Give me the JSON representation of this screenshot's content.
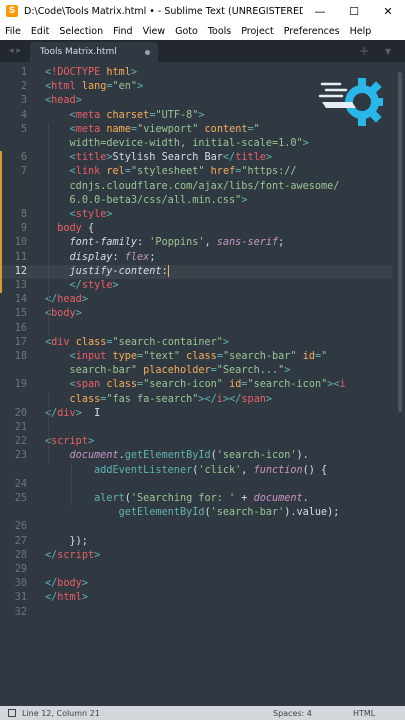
{
  "window": {
    "title": "D:\\Code\\Tools Matrix.html • - Sublime Text (UNREGISTERED)",
    "minimize_glyph": "—",
    "maximize_glyph": "☐",
    "close_glyph": "✕"
  },
  "menu": [
    "File",
    "Edit",
    "Selection",
    "Find",
    "View",
    "Goto",
    "Tools",
    "Project",
    "Preferences",
    "Help"
  ],
  "tab": {
    "label": "Tools Matrix.html",
    "nav_left": "◂ ▸",
    "right_controls": "+ ▾"
  },
  "editor": {
    "current_line": 12,
    "lines": [
      {
        "n": "1",
        "t": [
          [
            "p",
            "<"
          ],
          [
            "tag",
            "!DOCTYPE"
          ],
          [
            "txt",
            " "
          ],
          [
            "attr",
            "html"
          ],
          [
            "p",
            ">"
          ]
        ]
      },
      {
        "n": "2",
        "t": [
          [
            "p",
            "<"
          ],
          [
            "tag",
            "html"
          ],
          [
            "txt",
            " "
          ],
          [
            "attr",
            "lang"
          ],
          [
            "p",
            "="
          ],
          [
            "str",
            "\"en\""
          ],
          [
            "p",
            ">"
          ]
        ]
      },
      {
        "n": "3",
        "t": [
          [
            "p",
            "<"
          ],
          [
            "tag",
            "head"
          ],
          [
            "p",
            ">"
          ]
        ]
      },
      {
        "n": "4",
        "t": [
          [
            "txt",
            "    "
          ],
          [
            "p",
            "<"
          ],
          [
            "tag",
            "meta"
          ],
          [
            "txt",
            " "
          ],
          [
            "attr",
            "charset"
          ],
          [
            "p",
            "="
          ],
          [
            "str",
            "\"UTF-8\""
          ],
          [
            "p",
            ">"
          ]
        ]
      },
      {
        "n": "5",
        "t": [
          [
            "txt",
            "    "
          ],
          [
            "p",
            "<"
          ],
          [
            "tag",
            "meta"
          ],
          [
            "txt",
            " "
          ],
          [
            "attr",
            "name"
          ],
          [
            "p",
            "="
          ],
          [
            "str",
            "\"viewport\""
          ],
          [
            "txt",
            " "
          ],
          [
            "attr",
            "content"
          ],
          [
            "p",
            "="
          ],
          [
            "str",
            "\""
          ]
        ]
      },
      {
        "n": "",
        "t": [
          [
            "txt",
            "    "
          ],
          [
            "str",
            "width=device-width, initial-scale=1.0\""
          ],
          [
            "p",
            ">"
          ]
        ]
      },
      {
        "n": "6",
        "t": [
          [
            "txt",
            "    "
          ],
          [
            "p",
            "<"
          ],
          [
            "tag",
            "title"
          ],
          [
            "p",
            ">"
          ],
          [
            "txt",
            "Stylish Search Bar"
          ],
          [
            "p",
            "</"
          ],
          [
            "tag",
            "title"
          ],
          [
            "p",
            ">"
          ]
        ]
      },
      {
        "n": "7",
        "t": [
          [
            "txt",
            "    "
          ],
          [
            "p",
            "<"
          ],
          [
            "tag",
            "link"
          ],
          [
            "txt",
            " "
          ],
          [
            "attr",
            "rel"
          ],
          [
            "p",
            "="
          ],
          [
            "str",
            "\"stylesheet\""
          ],
          [
            "txt",
            " "
          ],
          [
            "attr",
            "href"
          ],
          [
            "p",
            "="
          ],
          [
            "str",
            "\"https://"
          ]
        ]
      },
      {
        "n": "",
        "t": [
          [
            "txt",
            "    "
          ],
          [
            "str",
            "cdnjs.cloudflare.com/ajax/libs/font-awesome/"
          ]
        ]
      },
      {
        "n": "",
        "t": [
          [
            "txt",
            "    "
          ],
          [
            "str",
            "6.0.0-beta3/css/all.min.css\""
          ],
          [
            "p",
            ">"
          ]
        ]
      },
      {
        "n": "8",
        "t": [
          [
            "txt",
            "    "
          ],
          [
            "p",
            "<"
          ],
          [
            "tag",
            "style"
          ],
          [
            "p",
            ">"
          ]
        ]
      },
      {
        "n": "9",
        "t": [
          [
            "txt",
            "  "
          ],
          [
            "tag",
            "body"
          ],
          [
            "txt",
            " {"
          ]
        ]
      },
      {
        "n": "10",
        "t": [
          [
            "txt",
            "    "
          ],
          [
            "prop",
            "font-family"
          ],
          [
            "txt",
            ": "
          ],
          [
            "str",
            "'Poppins'"
          ],
          [
            "txt",
            ", "
          ],
          [
            "dt",
            "sans-serif"
          ],
          [
            "txt",
            ";"
          ]
        ]
      },
      {
        "n": "11",
        "t": [
          [
            "txt",
            "    "
          ],
          [
            "prop",
            "display"
          ],
          [
            "txt",
            ": "
          ],
          [
            "dt",
            "flex"
          ],
          [
            "txt",
            ";"
          ]
        ]
      },
      {
        "n": "12",
        "t": [
          [
            "txt",
            "    "
          ],
          [
            "prop",
            "justify-content"
          ],
          [
            "txt",
            ":"
          ]
        ],
        "caret": true
      },
      {
        "n": "13",
        "t": [
          [
            "txt",
            "    "
          ],
          [
            "p",
            "</"
          ],
          [
            "tag",
            "style"
          ],
          [
            "p",
            ">"
          ]
        ]
      },
      {
        "n": "14",
        "t": [
          [
            "p",
            "</"
          ],
          [
            "tag",
            "head"
          ],
          [
            "p",
            ">"
          ]
        ]
      },
      {
        "n": "15",
        "t": [
          [
            "p",
            "<"
          ],
          [
            "tag",
            "body"
          ],
          [
            "p",
            ">"
          ]
        ]
      },
      {
        "n": "16",
        "t": []
      },
      {
        "n": "17",
        "t": [
          [
            "p",
            "<"
          ],
          [
            "tag",
            "div"
          ],
          [
            "txt",
            " "
          ],
          [
            "attr",
            "class"
          ],
          [
            "p",
            "="
          ],
          [
            "str",
            "\"search-container\""
          ],
          [
            "p",
            ">"
          ]
        ]
      },
      {
        "n": "18",
        "t": [
          [
            "txt",
            "    "
          ],
          [
            "p",
            "<"
          ],
          [
            "tag",
            "input"
          ],
          [
            "txt",
            " "
          ],
          [
            "attr",
            "type"
          ],
          [
            "p",
            "="
          ],
          [
            "str",
            "\"text\""
          ],
          [
            "txt",
            " "
          ],
          [
            "attr",
            "class"
          ],
          [
            "p",
            "="
          ],
          [
            "str",
            "\"search-bar\""
          ],
          [
            "txt",
            " "
          ],
          [
            "attr",
            "id"
          ],
          [
            "p",
            "="
          ],
          [
            "str",
            "\""
          ]
        ]
      },
      {
        "n": "",
        "t": [
          [
            "txt",
            "    "
          ],
          [
            "str",
            "search-bar\""
          ],
          [
            "txt",
            " "
          ],
          [
            "attr",
            "placeholder"
          ],
          [
            "p",
            "="
          ],
          [
            "str",
            "\"Search...\""
          ],
          [
            "p",
            ">"
          ]
        ]
      },
      {
        "n": "19",
        "t": [
          [
            "txt",
            "    "
          ],
          [
            "p",
            "<"
          ],
          [
            "tag",
            "span"
          ],
          [
            "txt",
            " "
          ],
          [
            "attr",
            "class"
          ],
          [
            "p",
            "="
          ],
          [
            "str",
            "\"search-icon\""
          ],
          [
            "txt",
            " "
          ],
          [
            "attr",
            "id"
          ],
          [
            "p",
            "="
          ],
          [
            "str",
            "\"search-icon\""
          ],
          [
            "p",
            ">"
          ],
          [
            "p",
            "<"
          ],
          [
            "tag",
            "i"
          ]
        ]
      },
      {
        "n": "",
        "t": [
          [
            "txt",
            "    "
          ],
          [
            "attr",
            "class"
          ],
          [
            "p",
            "="
          ],
          [
            "str",
            "\"fas fa-search\""
          ],
          [
            "p",
            "></"
          ],
          [
            "tag",
            "i"
          ],
          [
            "p",
            "></"
          ],
          [
            "tag",
            "span"
          ],
          [
            "p",
            ">"
          ]
        ]
      },
      {
        "n": "20",
        "t": [
          [
            "p",
            "</"
          ],
          [
            "tag",
            "div"
          ],
          [
            "p",
            ">"
          ],
          [
            "txt",
            "  "
          ],
          [
            "txt",
            "I"
          ]
        ]
      },
      {
        "n": "21",
        "t": []
      },
      {
        "n": "22",
        "t": [
          [
            "p",
            "<"
          ],
          [
            "tag",
            "script"
          ],
          [
            "p",
            ">"
          ]
        ]
      },
      {
        "n": "23",
        "t": [
          [
            "txt",
            "    "
          ],
          [
            "dt",
            "document"
          ],
          [
            "txt",
            "."
          ],
          [
            "fn",
            "getElementById"
          ],
          [
            "txt",
            "("
          ],
          [
            "str",
            "'search-icon'"
          ],
          [
            "txt",
            ")."
          ]
        ]
      },
      {
        "n": "",
        "t": [
          [
            "txt",
            "        "
          ],
          [
            "fn",
            "addEventListener"
          ],
          [
            "txt",
            "("
          ],
          [
            "str",
            "'click'"
          ],
          [
            "txt",
            ", "
          ],
          [
            "kw",
            "function"
          ],
          [
            "txt",
            "() {"
          ]
        ]
      },
      {
        "n": "24",
        "t": []
      },
      {
        "n": "25",
        "t": [
          [
            "txt",
            "        "
          ],
          [
            "fn",
            "alert"
          ],
          [
            "txt",
            "("
          ],
          [
            "str",
            "'Searching for: '"
          ],
          [
            "txt",
            " + "
          ],
          [
            "dt",
            "document"
          ],
          [
            "txt",
            "."
          ]
        ]
      },
      {
        "n": "",
        "t": [
          [
            "txt",
            "            "
          ],
          [
            "fn",
            "getElementById"
          ],
          [
            "txt",
            "("
          ],
          [
            "str",
            "'search-bar'"
          ],
          [
            "txt",
            ").value);"
          ]
        ]
      },
      {
        "n": "26",
        "t": []
      },
      {
        "n": "27",
        "t": [
          [
            "txt",
            "    });"
          ]
        ]
      },
      {
        "n": "28",
        "t": [
          [
            "p",
            "</"
          ],
          [
            "tag",
            "script"
          ],
          [
            "p",
            ">"
          ]
        ]
      },
      {
        "n": "29",
        "t": []
      },
      {
        "n": "30",
        "t": [
          [
            "p",
            "</"
          ],
          [
            "tag",
            "body"
          ],
          [
            "p",
            ">"
          ]
        ]
      },
      {
        "n": "31",
        "t": [
          [
            "p",
            "</"
          ],
          [
            "tag",
            "html"
          ],
          [
            "p",
            ">"
          ]
        ]
      },
      {
        "n": "32",
        "t": []
      }
    ]
  },
  "status": {
    "position": "Line 12, Column 21",
    "spaces": "Spaces: 4",
    "syntax": "HTML"
  },
  "colors": {
    "background": "#303841",
    "tag": "#ec5f66",
    "attribute": "#f9ae58",
    "string": "#99c794",
    "punctuation": "#5fb4b4",
    "keyword": "#c695c6",
    "logo": "#29b6e8"
  }
}
